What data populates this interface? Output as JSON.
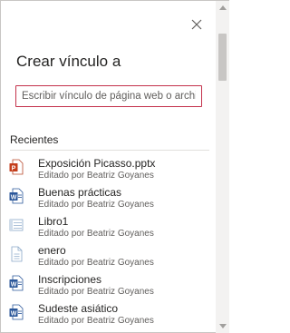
{
  "dialog": {
    "title": "Crear vínculo a",
    "close_icon": "close-icon"
  },
  "link_input": {
    "placeholder": "Escribir vínculo de página web o archivo",
    "value": ""
  },
  "recent": {
    "label": "Recientes",
    "items": [
      {
        "name": "Exposición Picasso.pptx",
        "meta": "Editado por Beatriz Goyanes",
        "icon": "powerpoint-file-icon"
      },
      {
        "name": "Buenas prácticas",
        "meta": "Editado por Beatriz Goyanes",
        "icon": "word-file-icon"
      },
      {
        "name": "Libro1",
        "meta": "Editado por Beatriz Goyanes",
        "icon": "generic-file-icon"
      },
      {
        "name": "enero",
        "meta": "Editado por Beatriz Goyanes",
        "icon": "generic-file-icon"
      },
      {
        "name": "Inscripciones",
        "meta": "Editado por Beatriz Goyanes",
        "icon": "word-file-icon"
      },
      {
        "name": "Sudeste asiático",
        "meta": "Editado por Beatriz Goyanes",
        "icon": "word-file-icon"
      }
    ]
  },
  "colors": {
    "input_border": "#c4314b",
    "powerpoint": "#c43e1c",
    "word": "#2b579a",
    "generic": "#8aa8c9"
  }
}
